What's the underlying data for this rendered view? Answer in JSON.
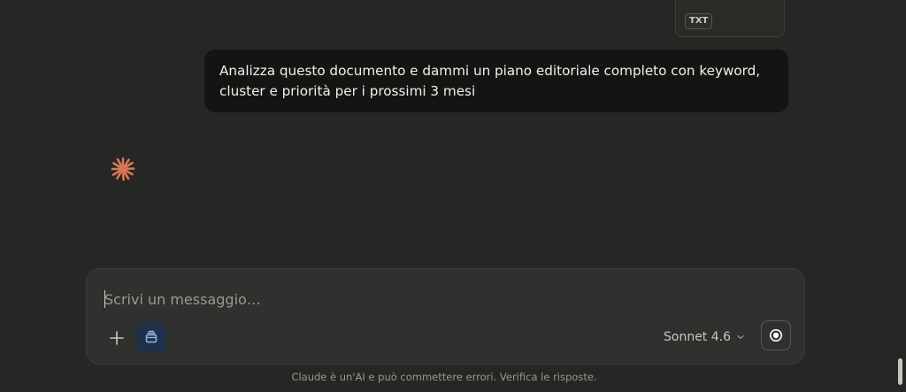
{
  "attachment": {
    "file_type": "TXT"
  },
  "conversation": {
    "user_message": "Analizza questo documento e dammi un piano editoriale completo con keyword, cluster e priorità per i prossimi 3 mesi",
    "assistant_icon": "claude-spark-icon"
  },
  "composer": {
    "placeholder": "Scrivi un messaggio…",
    "value": "",
    "add_icon": "plus-icon",
    "project_icon": "project-box-icon",
    "model_label": "Sonnet 4.6",
    "model_chevron_icon": "chevron-down-icon",
    "voice_icon": "voice-mode-icon"
  },
  "footer": {
    "disclaimer": "Claude è un'AI e può commettere errori. Verifica le risposte."
  },
  "colors": {
    "background": "#262624",
    "user_bubble": "#141413",
    "composer": "#30302e",
    "accent": "#d97757",
    "project_button": "#1e3148"
  }
}
